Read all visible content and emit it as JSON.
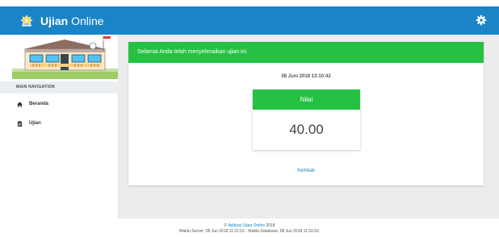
{
  "header": {
    "brand_bold": "Ujian",
    "brand_rest": " Online",
    "logo_icon": "tut-wuri-handayani-logo",
    "settings_icon": "gear-icon"
  },
  "sidebar": {
    "nav_heading": "MAIN NAVIGATION",
    "items": [
      {
        "label": "Beranda",
        "icon": "home-icon"
      },
      {
        "label": "Ujian",
        "icon": "clipboard-icon"
      }
    ]
  },
  "main": {
    "success_message": "Selamat Anda telah menyelesaikan ujian ini",
    "date": "08 Juni 2018 13:10:42",
    "score_label": "Nilai",
    "score_value": "40.00",
    "back_label": "Kembali"
  },
  "footer": {
    "copyright_prefix": "©",
    "app_link": "Aplikasi Ujian Online",
    "year": "2018",
    "server_time": "Waktu Server: 08 Jun 2018 11:31:52 - Waktu Database: 08 Jun 2018 11:31:52."
  },
  "colors": {
    "primary": "#1a84c6",
    "success": "#25c143",
    "content_bg": "#ececec"
  }
}
